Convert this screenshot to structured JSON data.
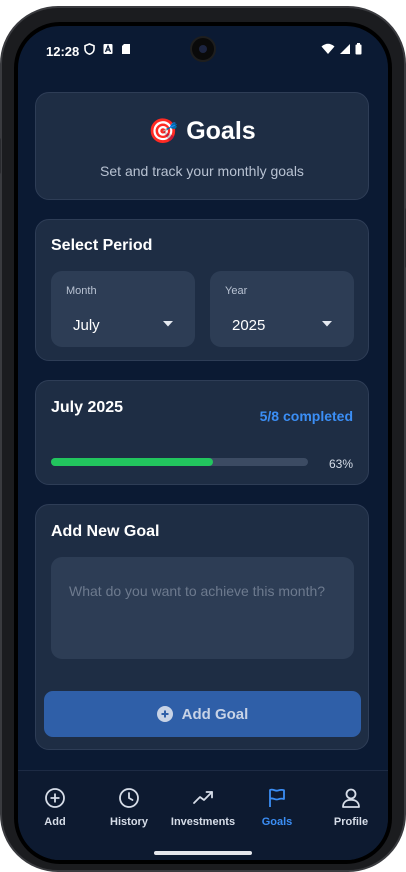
{
  "status_bar": {
    "time": "12:28"
  },
  "header": {
    "emoji": "🎯",
    "title": "Goals",
    "subtitle": "Set and track your monthly goals"
  },
  "period": {
    "title": "Select Period",
    "month": {
      "label": "Month",
      "value": "July"
    },
    "year": {
      "label": "Year",
      "value": "2025"
    }
  },
  "progress": {
    "title": "July 2025",
    "completed_text": "5/8 completed",
    "percent_text": "63%",
    "fraction": 0.63,
    "fill_color": "#22c55e"
  },
  "add_goal": {
    "title": "Add New Goal",
    "placeholder": "What do you want to achieve this month?",
    "button_label": "Add Goal"
  },
  "nav": {
    "items": [
      {
        "label": "Add",
        "icon": "plus-circle-icon"
      },
      {
        "label": "History",
        "icon": "clock-icon"
      },
      {
        "label": "Investments",
        "icon": "trending-up-icon"
      },
      {
        "label": "Goals",
        "icon": "flag-icon",
        "active": true
      },
      {
        "label": "Profile",
        "icon": "person-icon"
      }
    ]
  },
  "colors": {
    "background": "#0b1a33",
    "card": "#1e2d44",
    "accent": "#3b8ef5",
    "success": "#22c55e",
    "button": "#2f5fa8"
  }
}
